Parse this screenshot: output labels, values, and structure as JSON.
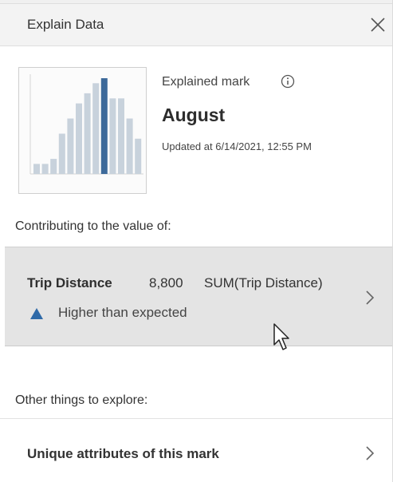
{
  "header": {
    "title": "Explain Data",
    "close_icon": "close-icon"
  },
  "explained_mark": {
    "label": "Explained mark",
    "info_icon": "info-icon",
    "value": "August",
    "updated": "Updated at 6/14/2021, 12:55 PM"
  },
  "thumbnail_chart": {
    "type": "bar",
    "values": [
      2,
      2,
      3,
      8,
      11,
      14,
      16,
      18,
      19,
      15,
      15,
      11,
      7
    ],
    "highlight_index": 8,
    "colors": {
      "bar": "#c8d2dc",
      "highlight": "#3d6a9a"
    }
  },
  "contributing": {
    "label": "Contributing to the value of:",
    "measure_name": "Trip Distance",
    "value": "8,800",
    "aggregation": "SUM(Trip Distance)",
    "status": "Higher than expected",
    "status_color": "#2f6aa8"
  },
  "explore": {
    "label": "Other things to explore:",
    "items": [
      {
        "label": "Unique attributes of this mark"
      }
    ]
  }
}
